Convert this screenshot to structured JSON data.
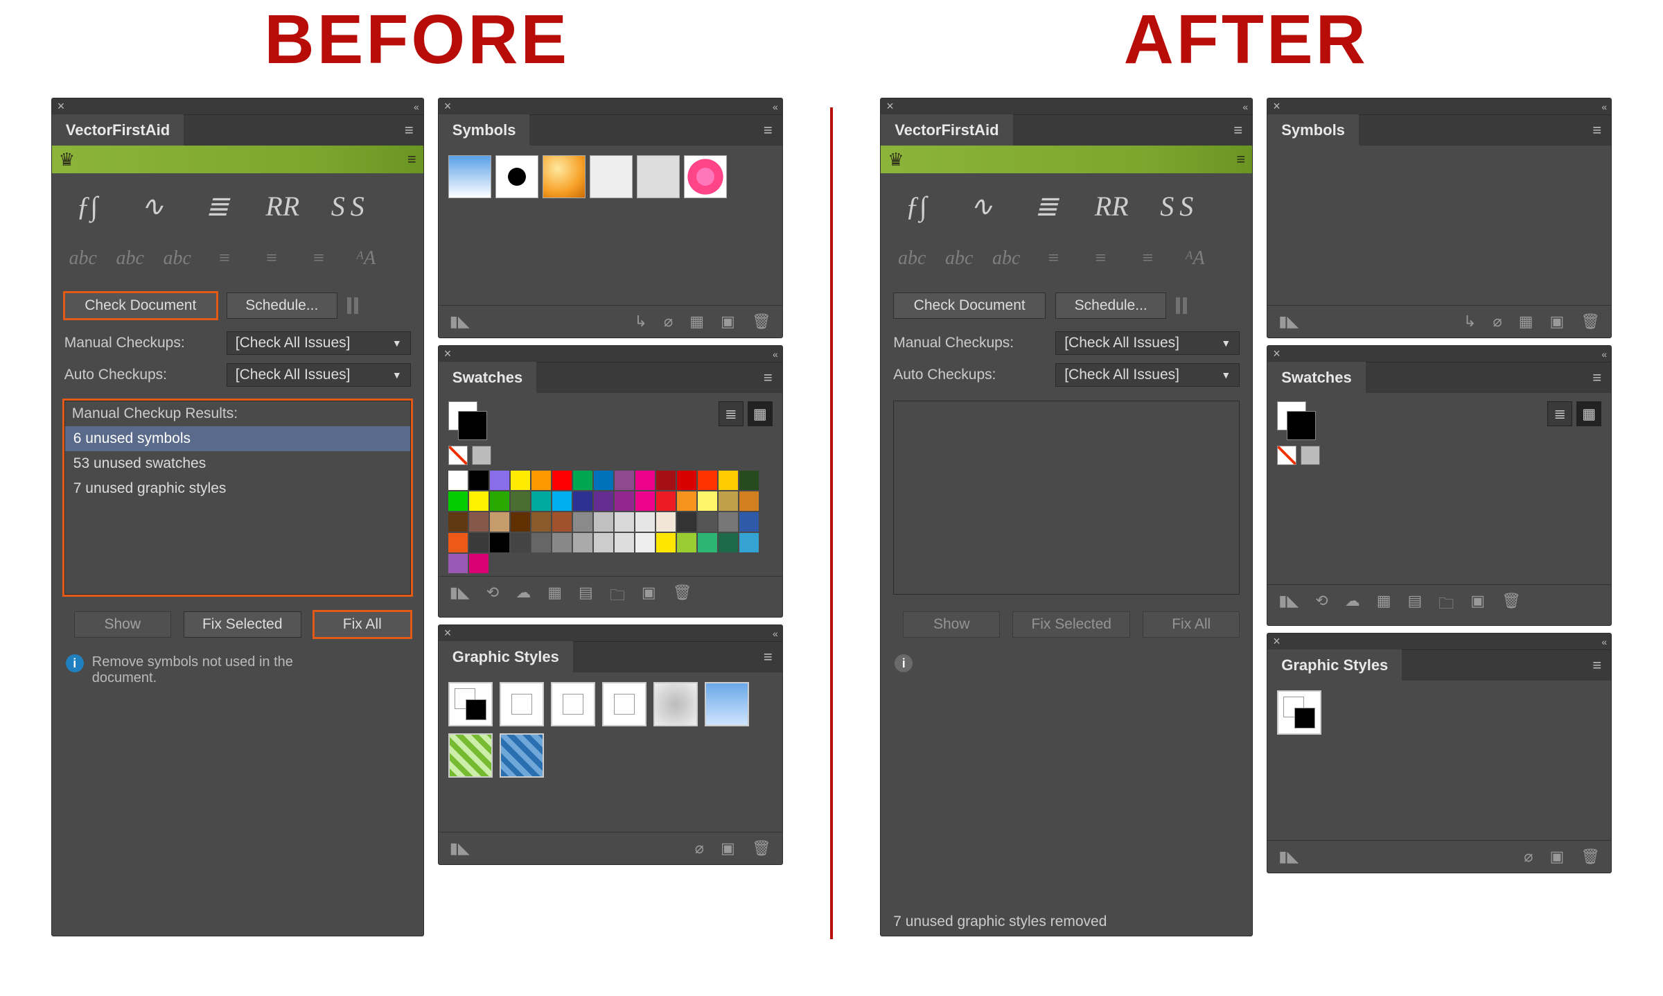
{
  "headings": {
    "before": "BEFORE",
    "after": "AFTER"
  },
  "vfa": {
    "title": "VectorFirstAid",
    "check_doc": "Check Document",
    "schedule": "Schedule...",
    "manual_label": "Manual Checkups:",
    "auto_label": "Auto Checkups:",
    "dropdown_value": "[Check All Issues]",
    "results_header": "Manual Checkup Results:",
    "show": "Show",
    "fix_selected": "Fix Selected",
    "fix_all": "Fix All",
    "help_text": "Remove symbols not used in the document.",
    "after_status": "7 unused graphic styles removed"
  },
  "results": [
    {
      "text": "6 unused symbols",
      "selected": true
    },
    {
      "text": "53 unused swatches",
      "selected": false
    },
    {
      "text": "7 unused graphic styles",
      "selected": false
    }
  ],
  "panels": {
    "symbols": "Symbols",
    "swatches": "Swatches",
    "graphic_styles": "Graphic Styles"
  },
  "swatch_colors": [
    "#fff",
    "#000",
    "#8a6de8",
    "#ffea00",
    "#ff9900",
    "#ff0000",
    "#00a651",
    "#0072bc",
    "#8f4a8f",
    "#ec008c",
    "#a50f15",
    "#d90000",
    "#ff3300",
    "#ffcc00",
    "#284a1f",
    "#00cc00",
    "#fff200",
    "#27a900",
    "#4a6e2f",
    "#00a99d",
    "#00aeef",
    "#2e3192",
    "#662d91",
    "#92278f",
    "#ec048c",
    "#ed1c24",
    "#f7941d",
    "#fff568",
    "#bfa14a",
    "#d27f1f",
    "#603913",
    "#87584a",
    "#c69c6d",
    "#603000",
    "#8b5a2b",
    "#a0522d",
    "#8a8a8a",
    "#c0c0c0",
    "#d9d9d9",
    "#e6e6e6",
    "#f2e6d9",
    "#333333",
    "#555555",
    "#777777",
    "#2e5aa8",
    "#ed5a17",
    "#3a3a3a",
    "#000",
    "#444",
    "#666",
    "#888",
    "#aaa",
    "#ccc",
    "#ddd",
    "#eee",
    "#ffe600",
    "#9acd32",
    "#2bb673",
    "#1d6a4a",
    "#35a2d4",
    "#9b59b6",
    "#d80073"
  ],
  "symbols_before": [
    "gradient",
    "splat",
    "orb",
    "ribbon",
    "spiro",
    "flower"
  ],
  "graphic_styles_before": [
    "default",
    "box-nudge",
    "plain",
    "split",
    "blur",
    "blue-grad",
    "swirl-green",
    "swirl-blue"
  ]
}
